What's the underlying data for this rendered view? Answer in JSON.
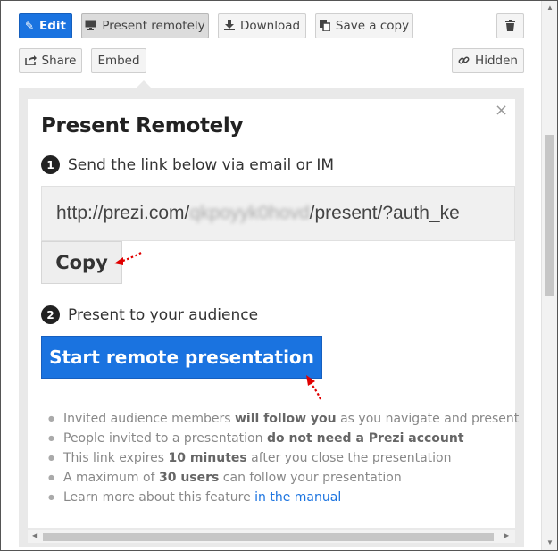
{
  "toolbar": {
    "edit_label": "Edit",
    "present_remotely_label": "Present remotely",
    "download_label": "Download",
    "save_copy_label": "Save a copy",
    "share_label": "Share",
    "embed_label": "Embed",
    "hidden_label": "Hidden"
  },
  "dialog": {
    "title": "Present Remotely",
    "close_glyph": "×",
    "step1": {
      "number": "1",
      "text": "Send the link below via email or IM"
    },
    "url": {
      "prefix": "http://prezi.com/",
      "blurred": "qkpoyyk0hovd",
      "suffix": "/present/?auth_ke"
    },
    "copy_label": "Copy",
    "step2": {
      "number": "2",
      "text": "Present to your audience"
    },
    "start_label": "Start remote presentation",
    "notes": [
      {
        "pre": "Invited audience members ",
        "bold": "will follow you",
        "post": " as you navigate and present"
      },
      {
        "pre": "People invited to a presentation ",
        "bold": "do not need a Prezi account",
        "post": ""
      },
      {
        "pre": "This link expires ",
        "bold": "10 minutes",
        "post": " after you close the presentation"
      },
      {
        "pre": "A maximum of ",
        "bold": "30 users",
        "post": " can follow your presentation"
      },
      {
        "pre": "Learn more about this feature ",
        "link": "in the manual"
      }
    ]
  },
  "colors": {
    "accent": "#1a73e0",
    "annotation": "#e00000"
  },
  "icons": [
    "pencil-icon",
    "monitor-icon",
    "download-icon",
    "copy-icon",
    "trash-icon",
    "share-icon",
    "link-icon",
    "close-icon"
  ]
}
